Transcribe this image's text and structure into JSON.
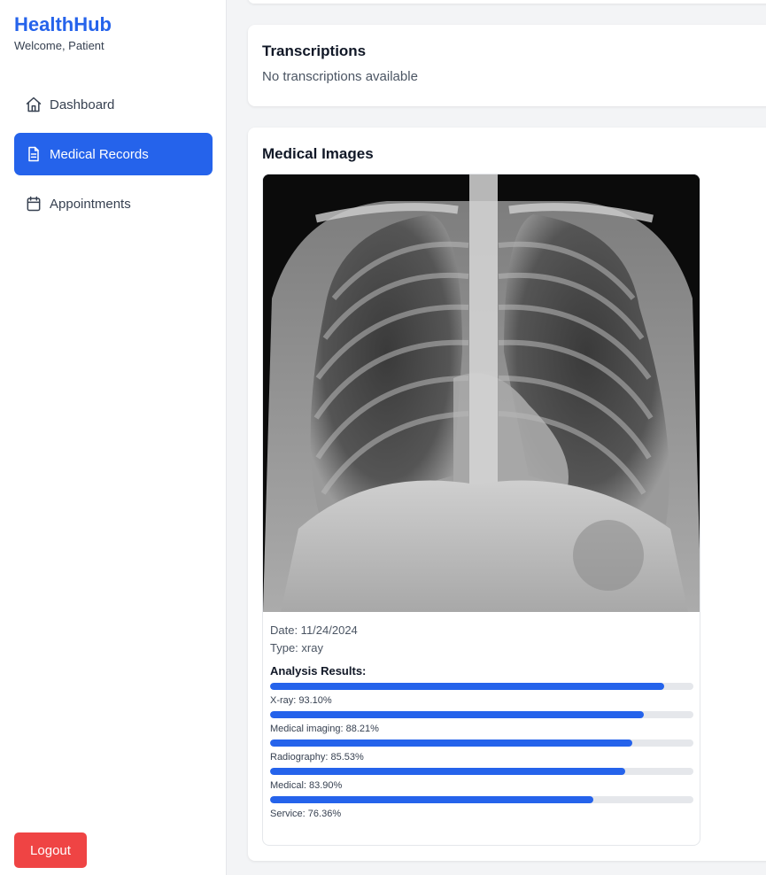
{
  "brand": {
    "title": "HealthHub",
    "subtitle": "Welcome, Patient"
  },
  "nav": [
    {
      "label": "Dashboard",
      "icon": "home-icon",
      "active": false
    },
    {
      "label": "Medical Records",
      "icon": "document-icon",
      "active": true
    },
    {
      "label": "Appointments",
      "icon": "calendar-icon",
      "active": false
    }
  ],
  "logout_label": "Logout",
  "transcriptions": {
    "title": "Transcriptions",
    "empty_text": "No transcriptions available"
  },
  "medical_images": {
    "title": "Medical Images",
    "image": {
      "date": "Date: 11/24/2024",
      "type": "Type: xray",
      "analysis_title": "Analysis Results:",
      "results": [
        {
          "label": "X-ray: 93.10%",
          "value": 93.1
        },
        {
          "label": "Medical imaging: 88.21%",
          "value": 88.21
        },
        {
          "label": "Radiography: 85.53%",
          "value": 85.53
        },
        {
          "label": "Medical: 83.90%",
          "value": 83.9
        },
        {
          "label": "Service: 76.36%",
          "value": 76.36
        }
      ]
    }
  },
  "colors": {
    "primary": "#2563eb",
    "danger": "#ef4444",
    "bg": "#f3f4f6"
  }
}
